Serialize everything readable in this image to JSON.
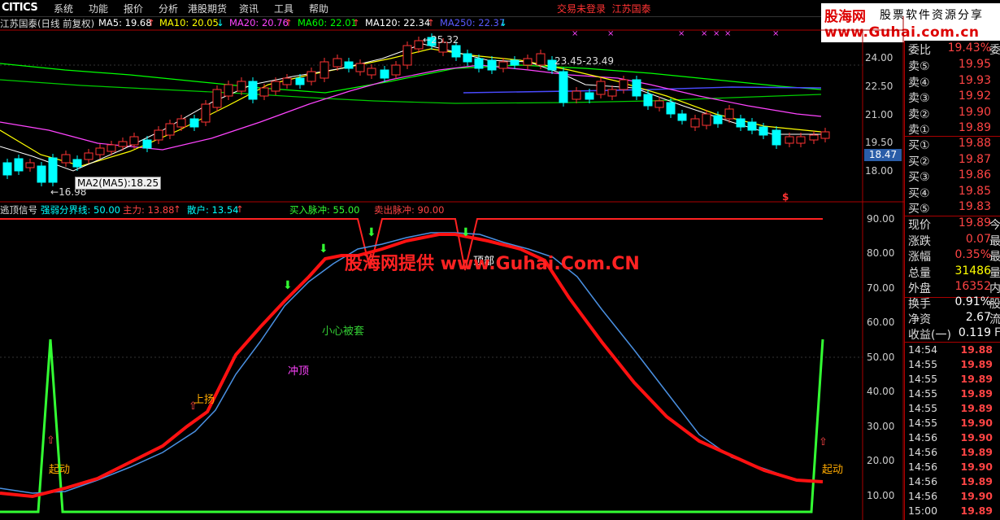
{
  "menubar": {
    "logo": "CITICS",
    "items": [
      "系统",
      "功能",
      "报价",
      "分析",
      "港股期货",
      "资讯",
      "工具",
      "帮助"
    ],
    "status": "交易未登录",
    "broker": "江苏国泰",
    "window_buttons": "_ ▫ ×"
  },
  "brand": {
    "name": "股海网",
    "tagline": "股票软件资源分享",
    "url": "www.Guhai.com.cn"
  },
  "main_chart": {
    "title": "江苏国泰(日线 前复权)",
    "ma": [
      {
        "label": "MA5: 19.68",
        "color": "#ffffff"
      },
      {
        "label": "MA10: 20.05",
        "color": "#ffff00"
      },
      {
        "label": "MA20: 20.76",
        "color": "#ff44ff"
      },
      {
        "label": "MA60: 22.01",
        "color": "#00ff00"
      },
      {
        "label": "MA120: 22.34",
        "color": "#ffffff"
      },
      {
        "label": "MA250: 22.37",
        "color": "#4a4aff"
      }
    ],
    "y_ticks": [
      "24.00",
      "22.50",
      "21.00",
      "19.50",
      "18.00"
    ],
    "current_price_tag": "18.47",
    "high_label": "25.32",
    "range_label": "23.45-23.49",
    "low_label": "16.98",
    "tooltip": "MA2(MA5):18.25",
    "colors": {
      "up": "#ff3333",
      "down": "#00ffff"
    }
  },
  "indicator": {
    "title": "逃顶信号",
    "line1": "强弱分界线: 50.00",
    "line2": "主力: 13.88",
    "line3": "散户: 13.54",
    "line4": "买入脉冲: 55.00",
    "line5": "卖出脉冲: 90.00",
    "y_ticks": [
      "90.00",
      "80.00",
      "70.00",
      "60.00",
      "50.00",
      "40.00",
      "30.00",
      "20.00",
      "10.00"
    ],
    "annotations": {
      "start_left": "起动",
      "start_right": "起动",
      "rise": "上扬",
      "rush": "冲顶",
      "caution": "小心被套",
      "top": "顶部"
    },
    "watermark": "股海网提供 www.Guhai.Com.CN"
  },
  "quote_panel": {
    "ratio": {
      "name": "委比",
      "value": "19.43%",
      "tail": "委"
    },
    "asks": [
      {
        "name": "卖⑤",
        "value": "19.95"
      },
      {
        "name": "卖④",
        "value": "19.93"
      },
      {
        "name": "卖③",
        "value": "19.92"
      },
      {
        "name": "卖②",
        "value": "19.90"
      },
      {
        "name": "卖①",
        "value": "19.89"
      }
    ],
    "bids": [
      {
        "name": "买①",
        "value": "19.88"
      },
      {
        "name": "买②",
        "value": "19.87"
      },
      {
        "name": "买③",
        "value": "19.86"
      },
      {
        "name": "买④",
        "value": "19.85"
      },
      {
        "name": "买⑤",
        "value": "19.83"
      }
    ],
    "stats": [
      {
        "name": "现价",
        "value": "19.89",
        "color": "#ff4444",
        "tail": "今"
      },
      {
        "name": "涨跌",
        "value": "0.07",
        "color": "#ff4444",
        "tail": "最"
      },
      {
        "name": "涨幅",
        "value": "0.35%",
        "color": "#ff4444",
        "tail": "最"
      },
      {
        "name": "总量",
        "value": "31486",
        "color": "#ffff00",
        "tail": "量"
      },
      {
        "name": "外盘",
        "value": "16352",
        "color": "#ff4444",
        "tail": "内"
      }
    ],
    "stats2": [
      {
        "name": "换手",
        "value": "0.91%",
        "color": "#ffffff",
        "tail": "股"
      },
      {
        "name": "净资",
        "value": "2.67",
        "color": "#ffffff",
        "tail": "流"
      },
      {
        "name": "收益(一)",
        "value": "0.119",
        "color": "#ffffff",
        "tail": "F"
      }
    ],
    "ticks": [
      {
        "time": "14:54",
        "price": "19.88"
      },
      {
        "time": "14:55",
        "price": "19.89"
      },
      {
        "time": "14:55",
        "price": "19.89"
      },
      {
        "time": "14:55",
        "price": "19.89"
      },
      {
        "time": "14:55",
        "price": "19.89"
      },
      {
        "time": "14:55",
        "price": "19.90"
      },
      {
        "time": "14:56",
        "price": "19.90"
      },
      {
        "time": "14:56",
        "price": "19.89"
      },
      {
        "time": "14:56",
        "price": "19.90"
      },
      {
        "time": "14:56",
        "price": "19.89"
      },
      {
        "time": "14:56",
        "price": "19.90"
      },
      {
        "time": "15:00",
        "price": "19.89"
      }
    ]
  }
}
